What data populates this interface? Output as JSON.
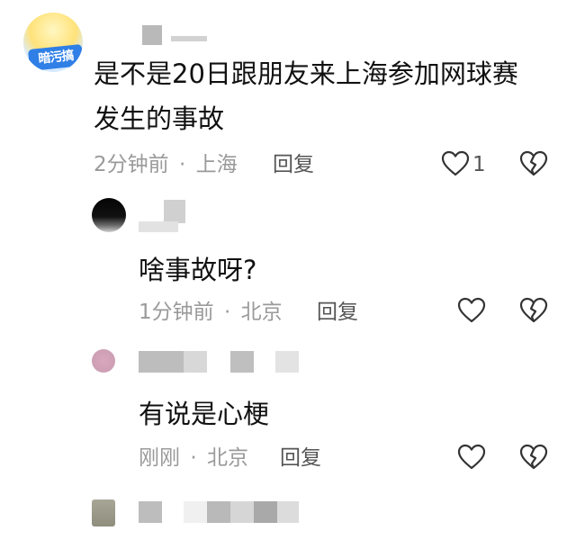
{
  "comments": [
    {
      "avatar_badge": "暗污搞",
      "text_line1": "是不是20日跟朋友来上海参加网球赛",
      "text_line2": "发生的事故",
      "time": "2分钟前",
      "separator": "·",
      "location": "上海",
      "reply_label": "回复",
      "like_count": "1"
    },
    {
      "text": "啥事故呀?",
      "time": "1分钟前",
      "separator": "·",
      "location": "北京",
      "reply_label": "回复"
    },
    {
      "text": "有说是心梗",
      "time": "刚刚",
      "separator": "·",
      "location": "北京",
      "reply_label": "回复"
    }
  ],
  "colors": {
    "text_primary": "#111111",
    "text_meta": "#9a9a9a",
    "icon_stroke": "#333333"
  }
}
